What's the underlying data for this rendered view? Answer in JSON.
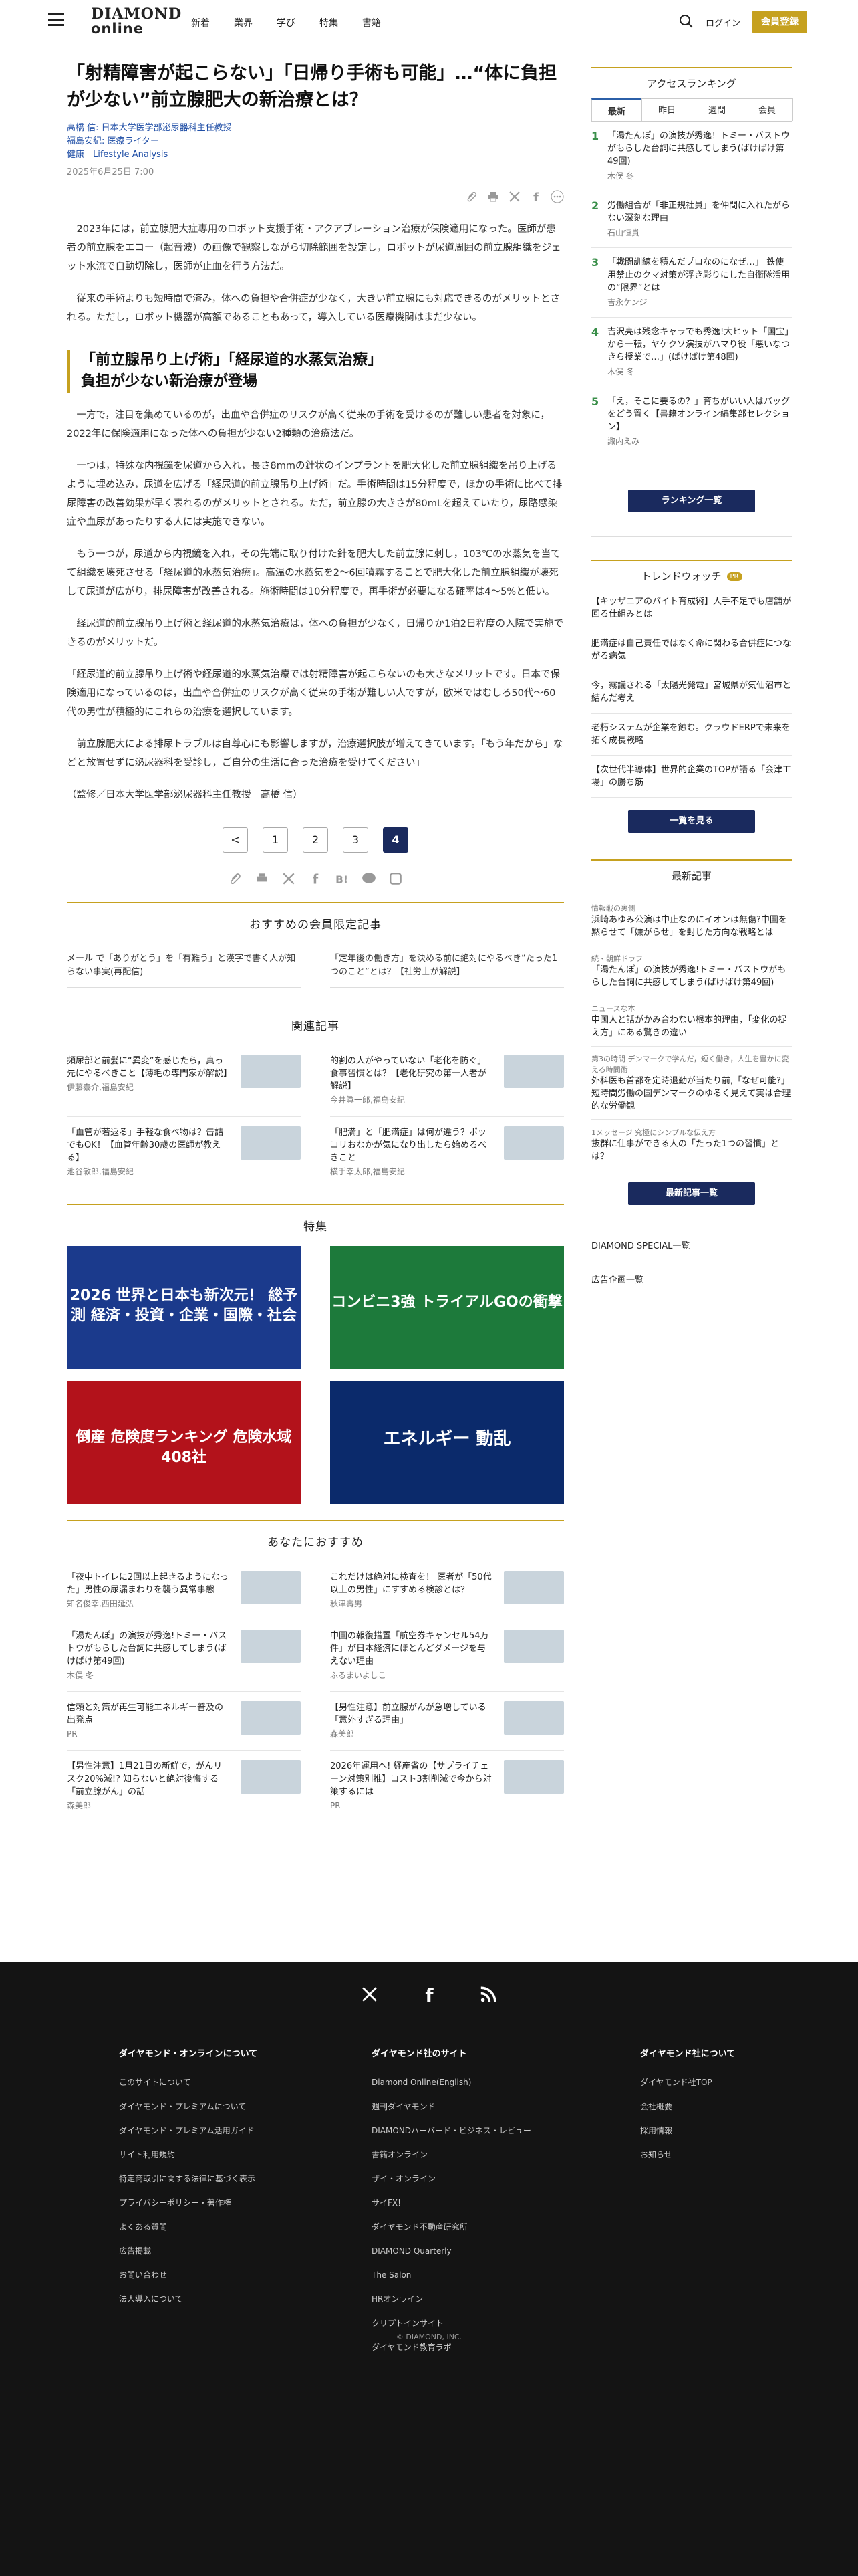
{
  "header": {
    "logo_line1": "DIAMOND",
    "logo_line2": "online",
    "nav": [
      "新着",
      "業界",
      "学び",
      "特集",
      "書籍"
    ],
    "login": "ログイン",
    "register": "会員登録"
  },
  "article": {
    "title": "「射精障害が起こらない」「日帰り手術も可能」…“体に負担が少ない”前立腺肥大の新治療とは？",
    "author": "高橋 信: 日本大学医学部泌尿器科主任教授",
    "author2": "福島安紀: 医療ライター",
    "tags": "健康　Lifestyle Analysis",
    "date": "2025年6月25日 7:00",
    "p1": "2023年には，前立腺肥大症専用のロボット支援手術・アクアブレーション治療が保険適用になった。医師が患者の前立腺をエコー（超音波）の画像で観察しながら切除範囲を設定し，ロボットが尿道周囲の前立腺組織をジェット水流で自動切除し，医師が止血を行う方法だ。",
    "p2": "従来の手術よりも短時間で済み，体への負担や合併症が少なく，大きい前立腺にも対応できるのがメリットとされる。ただし，ロボット機器が高額であることもあって，導入している医療機関はまだ少ない。",
    "h2a": "「前立腺吊り上げ術」「経尿道的水蒸気治療」",
    "h2b": "負担が少ない新治療が登場",
    "p3": "一方で，注目を集めているのが，出血や合併症のリスクが高く従来の手術を受けるのが難しい患者を対象に，2022年に保険適用になった体への負担が少ない2種類の治療法だ。",
    "p4": "一つは，特殊な内視鏡を尿道から入れ，長さ8mmの針状のインプラントを肥大化した前立腺組織を吊り上げるように埋め込み，尿道を広げる「経尿道的前立腺吊り上げ術」だ。手術時間は15分程度で，ほかの手術に比べて排尿障害の改善効果が早く表れるのがメリットとされる。ただ，前立腺の大きさが80mLを超えていたり，尿路感染症や血尿があったりする人には実施できない。",
    "p5": "もう一つが，尿道から内視鏡を入れ，その先端に取り付けた針を肥大した前立腺に刺し，103℃の水蒸気を当てて組織を壊死させる「経尿道的水蒸気治療」。高温の水蒸気を2〜6回噴霧することで肥大化した前立腺組織が壊死して尿道が広がり，排尿障害が改善される。施術時間は10分程度で，再手術が必要になる確率は4〜5%と低い。",
    "p6": "経尿道的前立腺吊り上げ術と経尿道的水蒸気治療は，体への負担が少なく，日帰りか1泊2日程度の入院で実施できるのがメリットだ。",
    "p7": "「経尿道的前立腺吊り上げ術や経尿道的水蒸気治療では射精障害が起こらないのも大きなメリットです。日本で保険適用になっているのは，出血や合併症のリスクが高く従来の手術が難しい人ですが，欧米ではむしろ50代〜60代の男性が積極的にこれらの治療を選択しています。",
    "p8": "前立腺肥大による排尿トラブルは自尊心にも影響しますが，治療選択肢が増えてきています。「もう年だから」などと放置せずに泌尿器科を受診し，ご自分の生活に合った治療を受けてください」",
    "p9": "（監修／日本大学医学部泌尿器科主任教授　高橋 信）"
  },
  "pager": [
    "<",
    "1",
    "2",
    "3",
    "4"
  ],
  "member": {
    "title": "おすすめの会員限定記事",
    "items": [
      "メール で「ありがとう」を「有難う」と漢字で書く人が知らない事実(再配信)",
      "「定年後の働き方」を決める前に絶対にやるべき“たった1つのこと”とは？【社労士が解説】"
    ]
  },
  "related": {
    "title": "関連記事",
    "items": [
      {
        "t": "頻尿部と前髪に“異変”を感じたら，真っ先にやるべきこと【薄毛の専門家が解説】",
        "a": "伊藤泰介,福島安紀"
      },
      {
        "t": "的割の人がやっていない「老化を防ぐ」食事習慣とは？【老化研究の第一人者が解説】",
        "a": "今井眞一郎,福島安紀"
      },
      {
        "t": "「血管が若返る」手軽な食べ物は？缶詰でもOK！【血管年齢30歳の医師が教える】",
        "a": "池谷敏郎,福島安紀"
      },
      {
        "t": "「肥満」と「肥満症」は何が違う？ポッコリおなかが気になり出したら始めるべきこと",
        "a": "横手幸太郎,福島安紀"
      }
    ]
  },
  "feature": {
    "title": "特集",
    "items": [
      "2026 世界と日本も新次元！ 総予測 経済・投資・企業・国際・社会",
      "コンビニ3強 トライアルGOの衝撃",
      "倒産 危険度ランキング 危険水域 408社",
      "エネルギー 動乱"
    ]
  },
  "recommend": {
    "title": "あなたにおすすめ",
    "items": [
      {
        "t": "「夜中トイレに2回以上起きるようになった」男性の尿漏まわりを襲う異常事態",
        "a": "知名俊幸,西田延弘"
      },
      {
        "t": "これだけは絶対に検査を！ 医者が「50代以上の男性」にすすめる検診とは？",
        "a": "秋津壽男"
      },
      {
        "t": "「湯たんぽ」の演技が秀逸!トミー・バストウがもらした台詞に共感してしまう(ばけばけ第49回)",
        "a": "木俣 冬"
      },
      {
        "t": "中国の報復措置「航空券キャンセル54万件」が日本経済にほとんどダメージを与えない理由",
        "a": "ふるまいよしこ"
      },
      {
        "t": "信頼と対策が再生可能エネルギー普及の出発点",
        "a": "PR"
      },
      {
        "t": "【男性注意】前立腺がんが急増している「意外すぎる理由」",
        "a": "森美郎"
      },
      {
        "t": "【男性注意】1月21日の新鮮で，がんリスク20%減!? 知らないと絶対後悔する「前立腺がん」の話",
        "a": "森美郎"
      },
      {
        "t": "2026年運用へ! 経産省の【サプライチェーン対策別推】コスト3割削減で今から対策するには",
        "a": "PR"
      }
    ]
  },
  "side": {
    "ranking_title": "アクセスランキング",
    "tabs": [
      "最新",
      "昨日",
      "週間",
      "会員"
    ],
    "ranks": [
      {
        "t": "「湯たんぽ」の演技が秀逸！トミー・バストウがもらした台詞に共感してしまう(ばけばけ第49回)",
        "a": "木俣 冬"
      },
      {
        "t": "労働組合が「非正規社員」を仲間に入れたがらない深刻な理由",
        "a": "石山恒貴"
      },
      {
        "t": "「戦闘訓練を積んだプロなのになぜ…」 鉄使用禁止のクマ対策が浮き彫りにした自衛隊活用の“限界”とは",
        "a": "吉永ケンジ"
      },
      {
        "t": "吉沢亮は残念キャラでも秀逸!大ヒット「国宝」から一転，ヤケクソ演技がハマり役「悪いなつきら授業で…」(ばけばけ第48回)",
        "a": "木俣 冬"
      },
      {
        "t": "「え，そこに要るの？」育ちがいい人はバッグをどう置く【書籍オンライン編集部セレクション】",
        "a": "諏内えみ"
      }
    ],
    "ranking_btn": "ランキング一覧",
    "trend_title": "トレンドウォッチ",
    "trend_pr": "PR",
    "trends": [
      "【キッザニアのバイト育成術】人手不足でも店舗が回る仕組みとは",
      "肥満症は自己責任ではなく命に関わる合併症につながる病気",
      "今，霧議される「太陽光発電」宮城県が気仙沼市と結んだ考え",
      "老朽システムが企業を蝕む。クラウドERPで未来を拓く成長戦略",
      "【次世代半導体】世界的企業のTOPが語る「会津工場」の勝ち筋"
    ],
    "trend_btn": "一覧を見る",
    "new_title": "最新記事",
    "news": [
      {
        "s": "情報戦の裏側",
        "t": "浜崎あゆみ公演は中止なのにイオンは無傷?中国を黙らせて「嫌がらせ」を封じた方向な戦略とは"
      },
      {
        "s": "続・朝鮮ドラフ",
        "t": "「湯たんぽ」の演技が秀逸!トミー・バストウがもらした台詞に共感してしまう(ばけばけ第49回)"
      },
      {
        "s": "ニュースな本",
        "t": "中国人と話がかみ合わない根本的理由，「変化の捉え方」にある驚きの違い"
      },
      {
        "s": "第3の時間 デンマークで学んだ，短く働き，人生を豊かに変える時間術",
        "t": "外科医も首都を定時退勤が当たり前,「なぜ可能?」短時間労働の国デンマークのゆるく見えて実は合理的な労働観"
      },
      {
        "s": "1メッセージ 究極にシンプルな伝え方",
        "t": "抜群に仕事ができる人の「たった1つの習慣」とは？"
      }
    ],
    "new_btn": "最新記事一覧",
    "links": [
      "DIAMOND SPECIAL一覧",
      "広告企画一覧"
    ]
  },
  "footer": {
    "col1_title": "ダイヤモンド・オンラインについて",
    "col1": [
      "このサイトについて",
      "ダイヤモンド・プレミアムについて",
      "ダイヤモンド・プレミアム活用ガイド",
      "サイト利用規約",
      "特定商取引に関する法律に基づく表示",
      "プライバシーポリシー・著作権",
      "よくある質問",
      "広告掲載",
      "お問い合わせ",
      "法人導入について"
    ],
    "col2_title": "ダイヤモンド社のサイト",
    "col2": [
      "Diamond Online(English)",
      "週刊ダイヤモンド",
      "DIAMONDハーバード・ビジネス・レビュー",
      "書籍オンライン",
      "ザイ・オンライン",
      "サイFX!",
      "ダイヤモンド不動産研究所",
      "DIAMOND Quarterly",
      "The Salon",
      "HRオンライン",
      "クリプトインサイト",
      "ダイヤモンド教育ラボ"
    ],
    "col3_title": "ダイヤモンド社について",
    "col3": [
      "ダイヤモンド社TOP",
      "会社概要",
      "採用情報",
      "お知らせ"
    ],
    "copyright": "© DIAMOND, INC."
  }
}
